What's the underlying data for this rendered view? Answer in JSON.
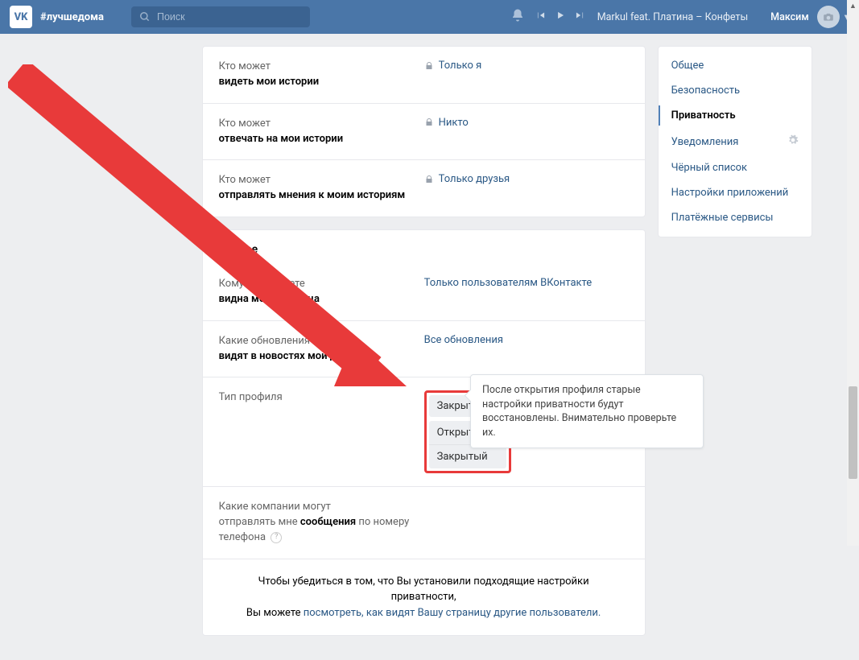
{
  "header": {
    "hashtag": "#лучшедома",
    "search_placeholder": "Поиск",
    "track": "Markul feat. Платина – Конфеты",
    "username": "Максим"
  },
  "settings_rows_a": [
    {
      "q1": "Кто может",
      "q2": "видеть мои истории",
      "val": "Только я",
      "lock": true
    },
    {
      "q1": "Кто может",
      "q2": "отвечать на мои истории",
      "val": "Никто",
      "lock": true
    },
    {
      "q1": "Кто может",
      "q2": "отправлять мнения к моим историям",
      "val": "Только друзья",
      "lock": true
    }
  ],
  "section_b_title": "Прочее",
  "settings_rows_b": [
    {
      "q1": "Кому в интернете",
      "q2": "видна моя страница",
      "val": "Только пользователям ВКонтакте"
    },
    {
      "q1": "Какие обновления",
      "q2": "видят в новостях мои друзья",
      "val": "Все обновления"
    }
  ],
  "profile_type": {
    "label": "Тип профиля",
    "selected": "Закрытый",
    "options": [
      "Открытый",
      "Закрытый"
    ]
  },
  "company_row": {
    "q1": "Какие компании могут",
    "q2a": "отправлять мне ",
    "q2b": "сообщения",
    "q2c": " по номеру телефона"
  },
  "tooltip": "После открытия профиля старые настройки приватности будут восстановлены. Внимательно проверьте их.",
  "footer": {
    "t1": "Чтобы убедиться в том, что Вы установили подходящие настройки приватности,",
    "t2": "Вы можете ",
    "link": "посмотреть, как видят Вашу страницу другие пользователи."
  },
  "sidebar": [
    "Общее",
    "Безопасность",
    "Приватность",
    "Уведомления",
    "Чёрный список",
    "Настройки приложений",
    "Платёжные сервисы"
  ],
  "sidebar_active": 2
}
